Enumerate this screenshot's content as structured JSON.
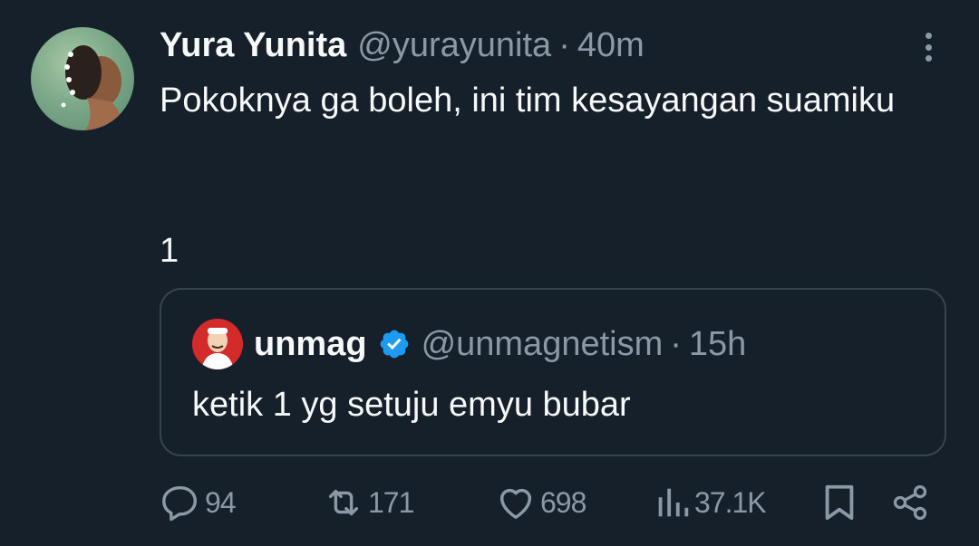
{
  "author": {
    "display_name": "Yura Yunita",
    "handle": "@yurayunita",
    "separator": "·",
    "time": "40m",
    "avatar_icon": "profile-photo-woman"
  },
  "tweet": {
    "text": "Pokoknya ga boleh, ini tim kesayangan suamiku",
    "number": "1"
  },
  "quote": {
    "display_name": "unmag",
    "verified_icon": "verified-badge-icon",
    "handle": "@unmagnetism",
    "separator": "·",
    "time": "15h",
    "text": "ketik 1 yg setuju emyu bubar"
  },
  "actions": {
    "replies": "94",
    "reposts": "171",
    "likes": "698",
    "views": "37.1K"
  },
  "colors": {
    "background": "#15202b",
    "text": "#f7f9f9",
    "muted": "#8b98a5",
    "border": "#38444d",
    "verified": "#1d9bf0"
  }
}
